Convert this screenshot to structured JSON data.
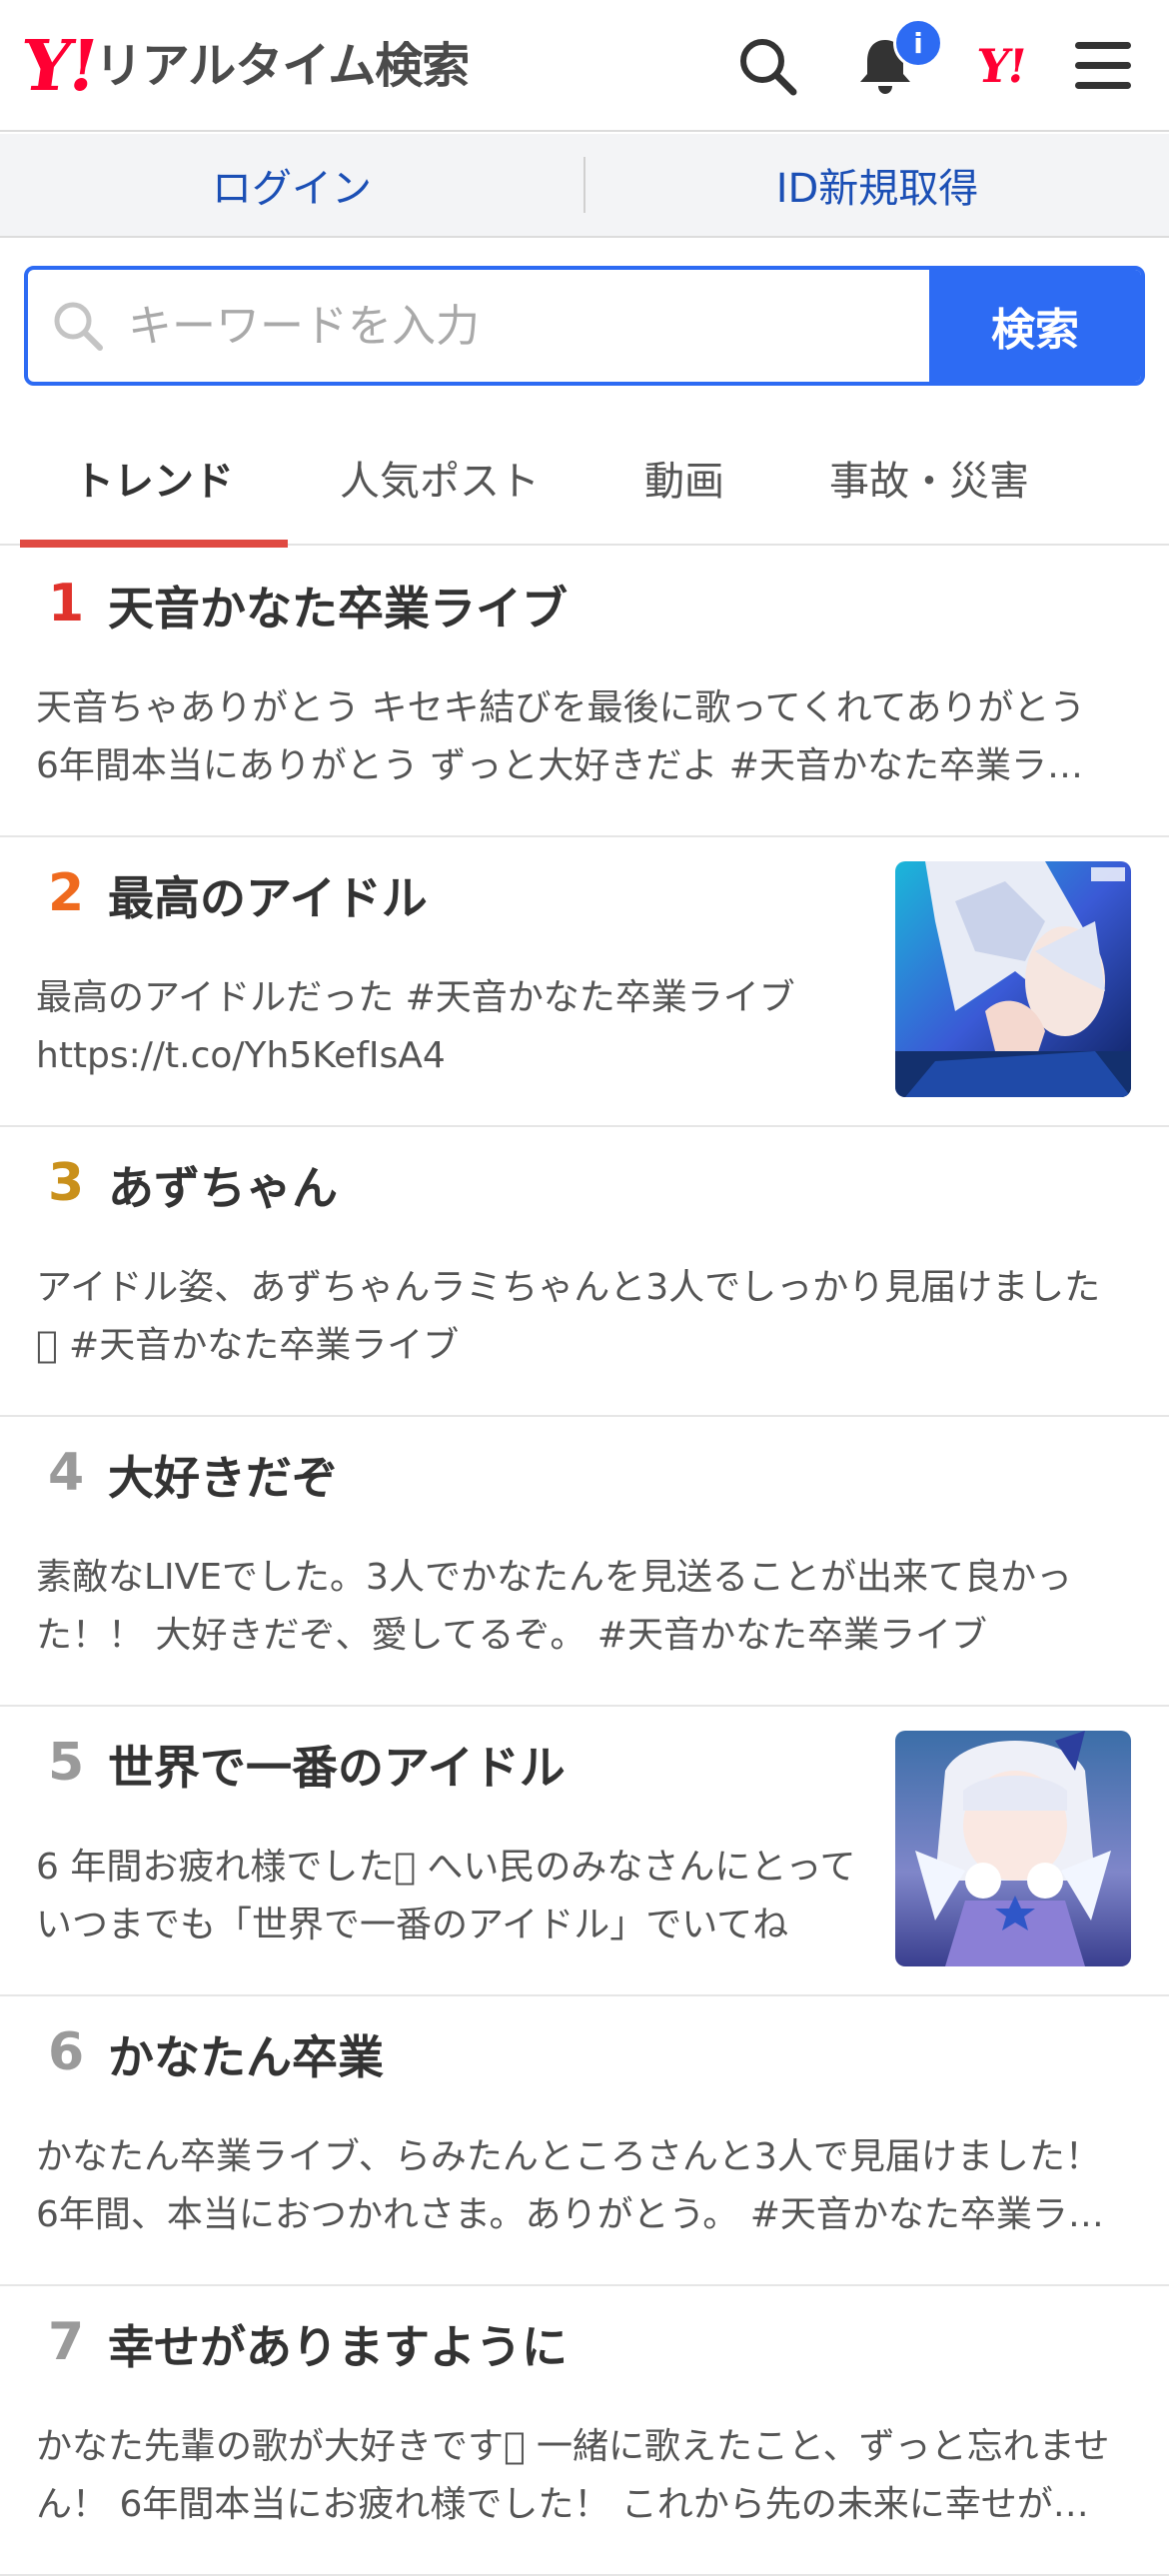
{
  "header": {
    "logo_mark": "Y!",
    "logo_text": "リアルタイム検索",
    "notification_badge": "i",
    "yahoo_mini": "Y!"
  },
  "auth": {
    "login": "ログイン",
    "signup": "ID新規取得"
  },
  "search": {
    "placeholder": "キーワードを入力",
    "button": "検索"
  },
  "tabs": [
    {
      "label": "トレンド",
      "active": true
    },
    {
      "label": "人気ポスト",
      "active": false
    },
    {
      "label": "動画",
      "active": false
    },
    {
      "label": "事故・災害",
      "active": false
    }
  ],
  "trends": [
    {
      "rank": "1",
      "title": "天音かなた卒業ライブ",
      "desc": "天音ちゃありがとう キセキ結びを最後に歌ってくれてありがとう 6年間本当にありがとう ずっと大好きだよ #天音かなた卒業ライブ",
      "color": "#e0322b"
    },
    {
      "rank": "2",
      "title": "最高のアイドル",
      "desc": "最高のアイドルだった #天音かなた卒業ライブ https://t.co/Yh5KefIsA4",
      "color": "#ef6a1e",
      "thumb": true
    },
    {
      "rank": "3",
      "title": "あずちゃん",
      "desc": "アイドル姿、あずちゃんラミちゃんと3人でしっかり見届けました􀀀 #天音かなた卒業ライブ",
      "color": "#c9901b"
    },
    {
      "rank": "4",
      "title": "大好きだぞ",
      "desc": "素敵なLIVEでした。3人でかなたんを見送ることが出来て良かった！！ 大好きだぞ、愛してるぞ。 #天音かなた卒業ライブ",
      "color": "#9a9a9a"
    },
    {
      "rank": "5",
      "title": "世界で一番のアイドル",
      "desc": "6 年間お疲れ様でした􀀀 へい民のみなさんにとって いつまでも「世界で一番のアイドル」でいてね",
      "color": "#9a9a9a",
      "thumb": true
    },
    {
      "rank": "6",
      "title": "かなたん卒業",
      "desc": "かなたん卒業ライブ、らみたんところさんと3人で見届けました！ 6年間、本当におつかれさま。ありがとう。 #天音かなた卒業ライブ",
      "color": "#9a9a9a"
    },
    {
      "rank": "7",
      "title": "幸せがありますように",
      "desc": "かなた先輩の歌が大好きです􀀀 一緒に歌えたこと、ずっと忘れません！ 6年間本当にお疲れ様でした！ これから先の未来に幸せがありますように",
      "color": "#9a9a9a"
    }
  ],
  "colors": {
    "accent_blue": "#2d6bf3",
    "brand_red": "#ff0033",
    "tab_underline": "#e04a42"
  }
}
